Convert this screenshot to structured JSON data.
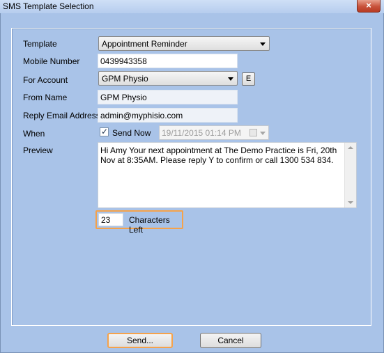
{
  "window": {
    "title": "SMS Template Selection",
    "close_glyph": "×"
  },
  "form": {
    "template": {
      "label": "Template",
      "value": "Appointment Reminder"
    },
    "mobile": {
      "label": "Mobile Number",
      "value": "0439943358"
    },
    "account": {
      "label": "For Account",
      "value": "GPM Physio",
      "edit_label": "E"
    },
    "from_name": {
      "label": "From Name",
      "value": "GPM Physio"
    },
    "reply_email": {
      "label": "Reply Email Address",
      "value": "admin@myphisio.com"
    },
    "when": {
      "label": "When",
      "send_now_label": "Send Now",
      "send_now_checked": true,
      "datetime": "19/11/2015 01:14 PM"
    },
    "preview": {
      "label": "Preview",
      "text": "Hi Amy Your next appointment at The Demo Practice is Fri, 20th Nov at 8:35AM. Please reply Y to confirm or call 1300 534 834."
    },
    "chars_left": {
      "count": "23",
      "label": "Characters Left"
    }
  },
  "buttons": {
    "send": "Send...",
    "cancel": "Cancel"
  },
  "colors": {
    "dialog_bg": "#a9c3e8",
    "focus_accent": "#f5a24b"
  }
}
